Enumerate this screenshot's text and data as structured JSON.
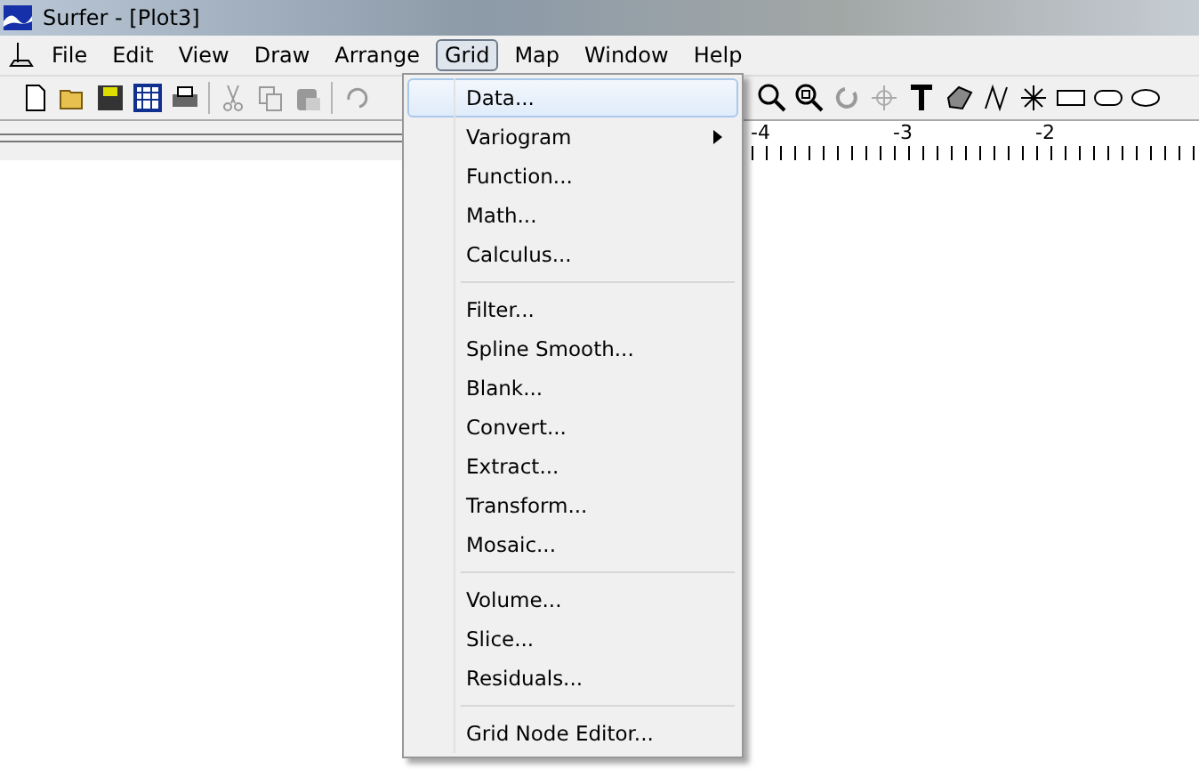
{
  "window": {
    "title": "Surfer - [Plot3]"
  },
  "menubar": [
    {
      "label": "File",
      "selected": false
    },
    {
      "label": "Edit",
      "selected": false
    },
    {
      "label": "View",
      "selected": false
    },
    {
      "label": "Draw",
      "selected": false
    },
    {
      "label": "Arrange",
      "selected": false
    },
    {
      "label": "Grid",
      "selected": true
    },
    {
      "label": "Map",
      "selected": false
    },
    {
      "label": "Window",
      "selected": false
    },
    {
      "label": "Help",
      "selected": false
    }
  ],
  "ruler": {
    "labels": [
      "-4",
      "-3",
      "-2"
    ]
  },
  "menu": [
    {
      "kind": "item",
      "label": "Data...",
      "selected": true
    },
    {
      "kind": "submenu",
      "label": "Variogram",
      "selected": false
    },
    {
      "kind": "item",
      "label": "Function...",
      "selected": false
    },
    {
      "kind": "item",
      "label": "Math...",
      "selected": false
    },
    {
      "kind": "item",
      "label": "Calculus...",
      "selected": false
    },
    {
      "kind": "separator"
    },
    {
      "kind": "item",
      "label": "Filter...",
      "selected": false
    },
    {
      "kind": "item",
      "label": "Spline Smooth...",
      "selected": false
    },
    {
      "kind": "item",
      "label": "Blank...",
      "selected": false
    },
    {
      "kind": "item",
      "label": "Convert...",
      "selected": false
    },
    {
      "kind": "item",
      "label": "Extract...",
      "selected": false
    },
    {
      "kind": "item",
      "label": "Transform...",
      "selected": false
    },
    {
      "kind": "item",
      "label": "Mosaic...",
      "selected": false
    },
    {
      "kind": "separator"
    },
    {
      "kind": "item",
      "label": "Volume...",
      "selected": false
    },
    {
      "kind": "item",
      "label": "Slice...",
      "selected": false
    },
    {
      "kind": "item",
      "label": "Residuals...",
      "selected": false
    },
    {
      "kind": "separator"
    },
    {
      "kind": "item",
      "label": "Grid Node Editor...",
      "selected": false
    }
  ]
}
